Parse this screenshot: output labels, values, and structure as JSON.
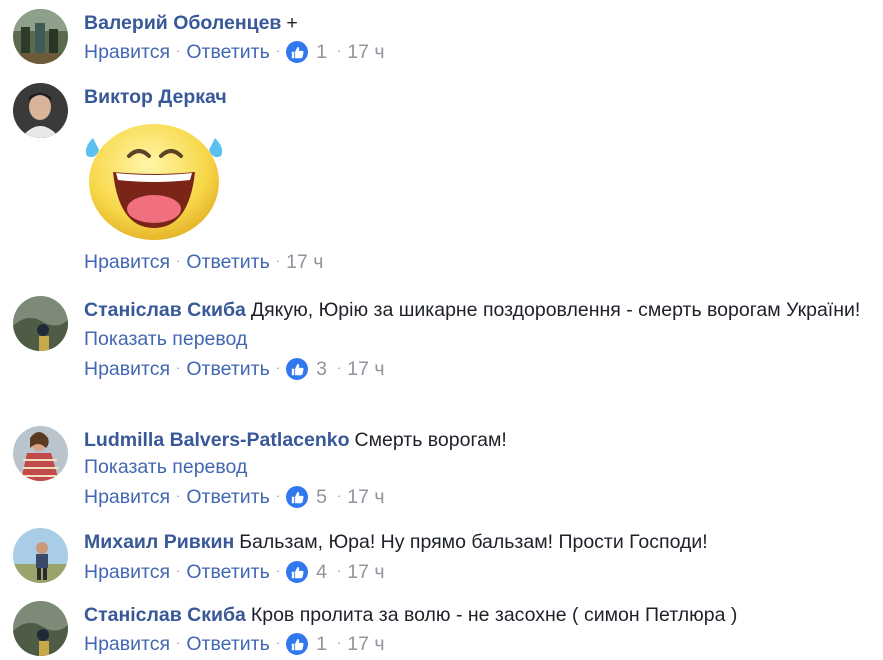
{
  "ui": {
    "dot": "·"
  },
  "comments": [
    {
      "author": "Валерий Оболенцев",
      "text": "+",
      "like_label": "Нравится",
      "reply_label": "Ответить",
      "likes": "1",
      "time": "17 ч"
    },
    {
      "author": "Виктор Деркач",
      "text": "",
      "sticker": "laughing-face-sticker",
      "like_label": "Нравится",
      "reply_label": "Ответить",
      "time": "17 ч"
    },
    {
      "author": "Станіслав Скиба",
      "text": "Дякую, Юрію за шикарне поздоровлення - смерть ворогам України!",
      "translate": "Показать перевод",
      "like_label": "Нравится",
      "reply_label": "Ответить",
      "likes": "3",
      "time": "17 ч"
    },
    {
      "author": "Ludmilla Balvers-Patlacenko",
      "text": "Смерть ворогам!",
      "translate": "Показать перевод",
      "like_label": "Нравится",
      "reply_label": "Ответить",
      "likes": "5",
      "time": "17 ч"
    },
    {
      "author": "Михаил Ривкин",
      "text": "Бальзам, Юра! Ну прямо бальзам! Прости Господи!",
      "like_label": "Нравится",
      "reply_label": "Ответить",
      "likes": "4",
      "time": "17 ч"
    },
    {
      "author": "Станіслав Скиба",
      "text": "Кров пролита за волю - не засохне ( симон Петлюра )",
      "like_label": "Нравится",
      "reply_label": "Ответить",
      "likes": "1",
      "time": "17 ч"
    }
  ],
  "colors": {
    "author_link": "#385898",
    "action_link": "#4267b2",
    "meta_gray": "#90949c",
    "like_blue": "#2f78f0"
  }
}
